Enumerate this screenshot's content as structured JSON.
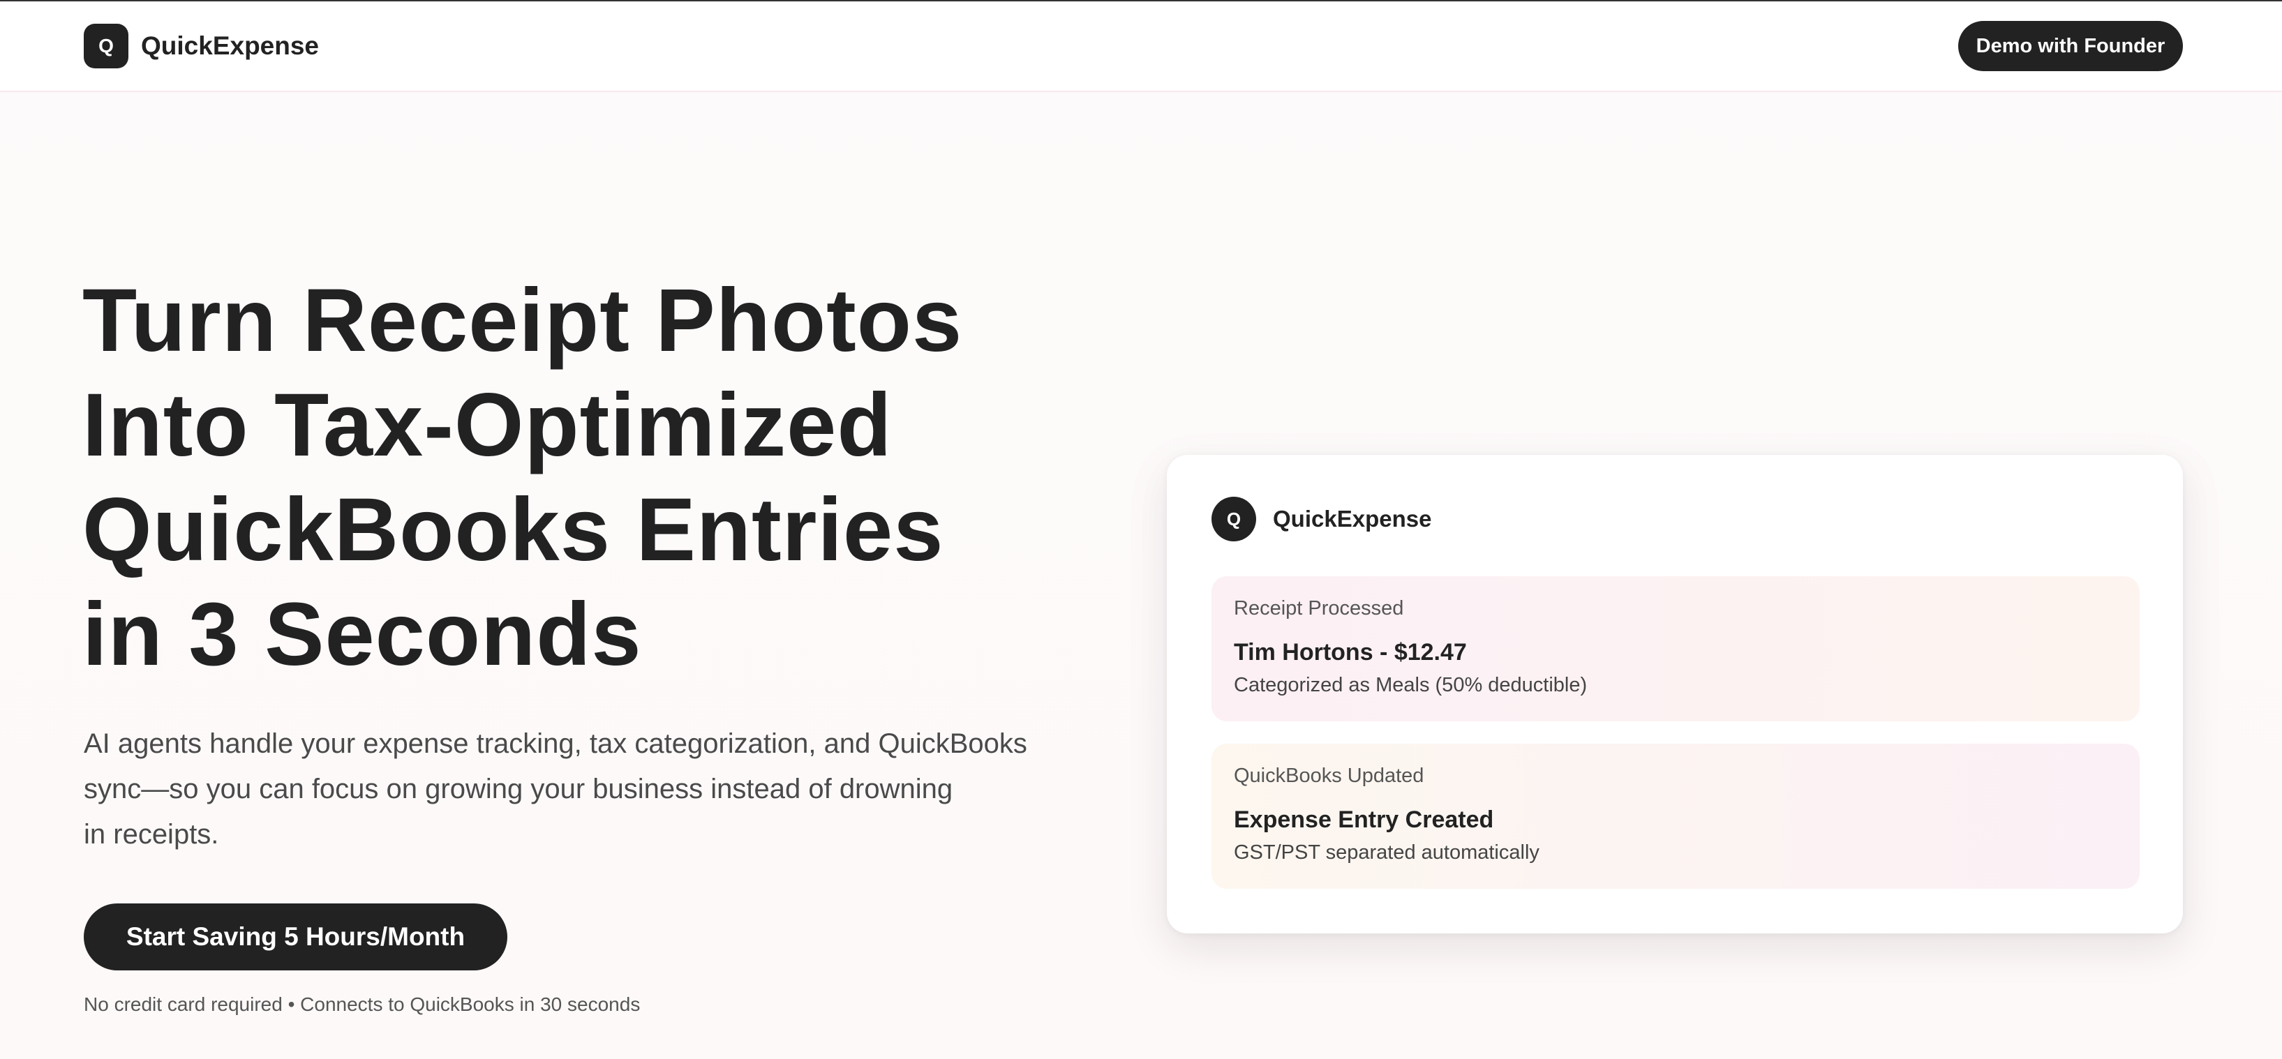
{
  "nav": {
    "logo_letter": "Q",
    "brand": "QuickExpense",
    "demo_button": "Demo with Founder"
  },
  "hero": {
    "title_lines": [
      "Turn Receipt Photos",
      "Into Tax-Optimized",
      "QuickBooks Entries",
      "in 3 Seconds"
    ],
    "subtitle_lines": [
      "AI agents handle your expense tracking, tax categorization, and QuickBooks",
      "sync—so you can focus on growing your business instead of drowning",
      "in receipts."
    ],
    "cta_button": "Start Saving 5 Hours/Month",
    "cta_note": "No credit card required • Connects to QuickBooks in 30 seconds"
  },
  "card": {
    "logo_letter": "Q",
    "brand": "QuickExpense",
    "panels": [
      {
        "label": "Receipt Processed",
        "title": "Tim Hortons - $12.47",
        "description": "Categorized as Meals (50% deductible)"
      },
      {
        "label": "QuickBooks Updated",
        "title": "Expense Entry Created",
        "description": "GST/PST separated automatically"
      }
    ]
  },
  "colors": {
    "primary_dark": "#222222",
    "background": "#fdfafb",
    "panel_pink": "#fcf0f5",
    "panel_peach": "#fdf7ef"
  },
  "icons": {
    "brand_logo": "q-logo-icon"
  }
}
